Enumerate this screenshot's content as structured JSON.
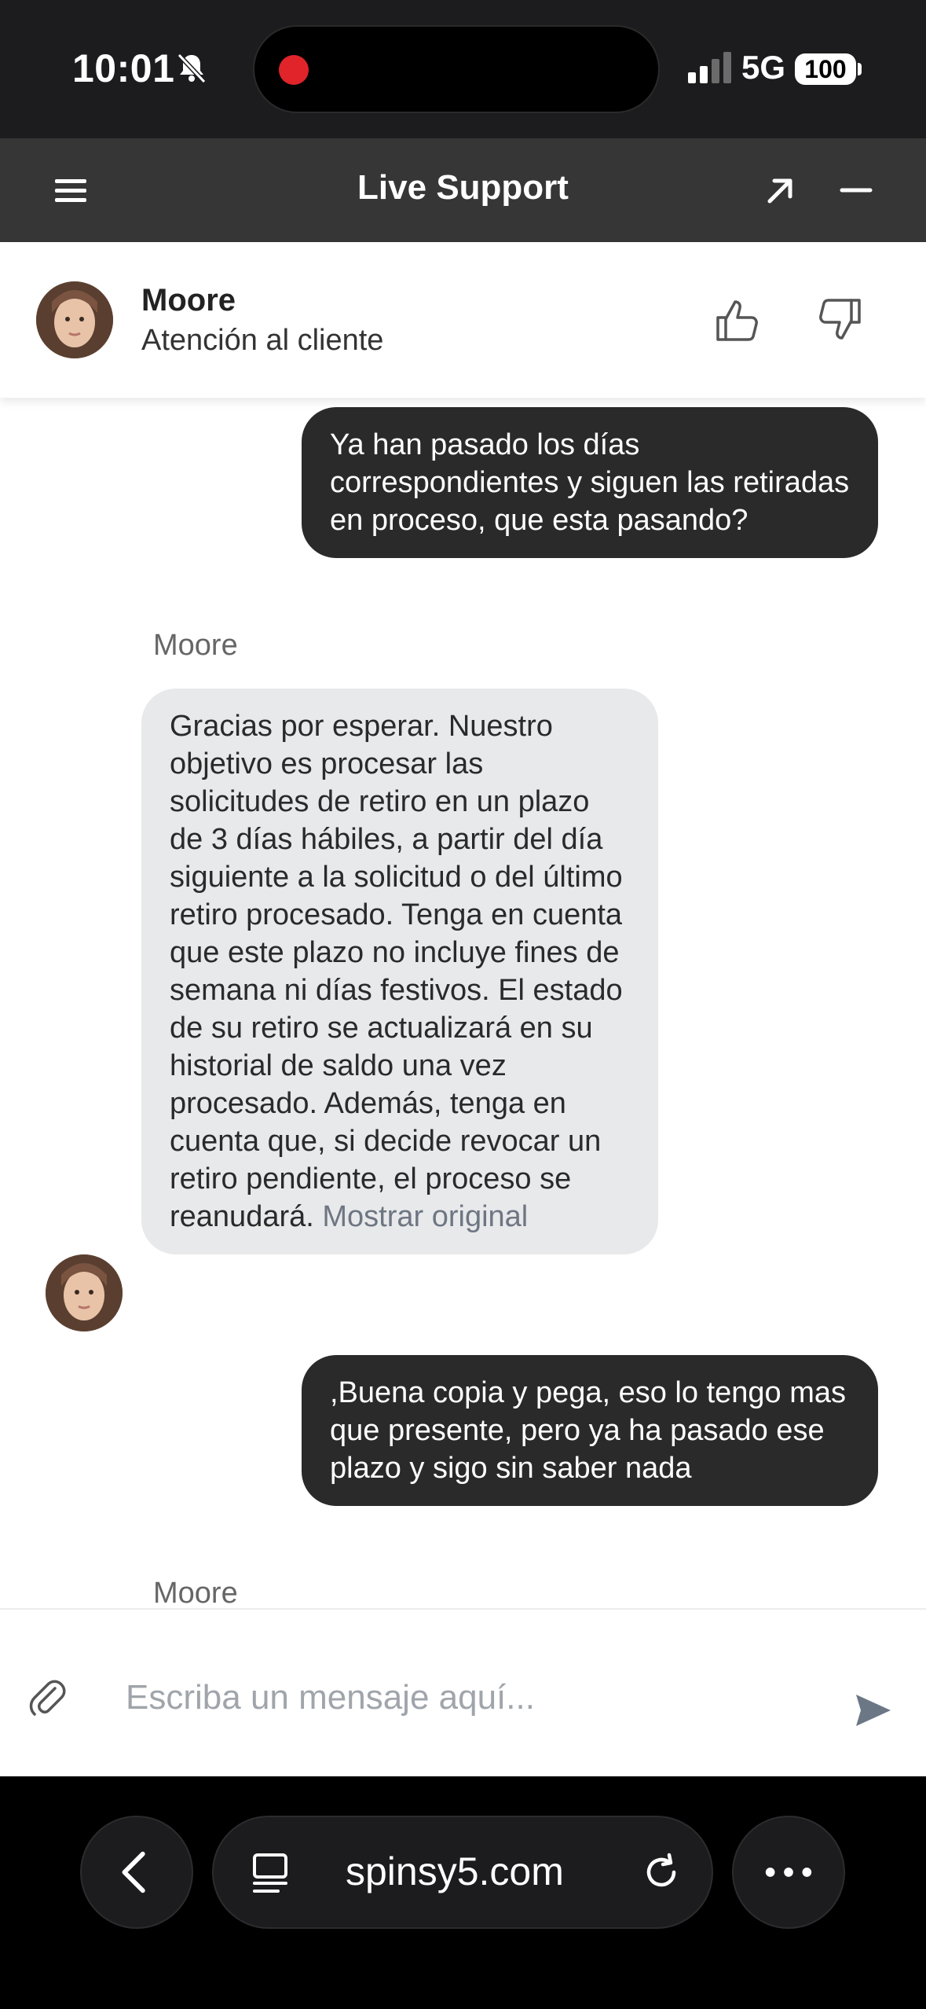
{
  "status_bar": {
    "time": "10:01",
    "network": "5G",
    "battery": "100"
  },
  "header": {
    "title": "Live Support",
    "menu_icon": "hamburger-menu-icon",
    "expand_icon": "arrow-up-right-icon",
    "minimize_icon": "minus-icon"
  },
  "agent": {
    "name": "Moore",
    "role": "Atención al cliente"
  },
  "messages": [
    {
      "direction": "outgoing",
      "text": "Ya han pasado los días correspondientes y siguen las retiradas en proceso, que esta pasando?"
    },
    {
      "direction": "incoming",
      "sender": "Moore",
      "text": "Gracias por esperar. Nuestro objetivo es procesar las solicitudes de retiro en un plazo de 3 días hábiles, a partir del día siguiente a la solicitud o del último retiro procesado. Tenga en cuenta que este plazo no incluye fines de semana ni días festivos. El estado de su retiro se actualizará en su historial de saldo una vez procesado. Además, tenga en cuenta que, si decide revocar un retiro pendiente, el proceso se reanudará.",
      "action": "Mostrar original"
    },
    {
      "direction": "outgoing",
      "text": ",Buena copia y pega, eso lo tengo mas que presente, pero ya ha pasado ese plazo y sigo sin saber nada"
    },
    {
      "direction": "incoming",
      "sender": "Moore"
    }
  ],
  "composer": {
    "placeholder": "Escriba un mensaje aquí..."
  },
  "browser": {
    "url": "spinsy5.com"
  },
  "colors": {
    "header_bg": "#363636",
    "outgoing_bubble": "#2a2a2a",
    "incoming_bubble": "#e8e9eb",
    "record_dot": "#e0242a"
  }
}
